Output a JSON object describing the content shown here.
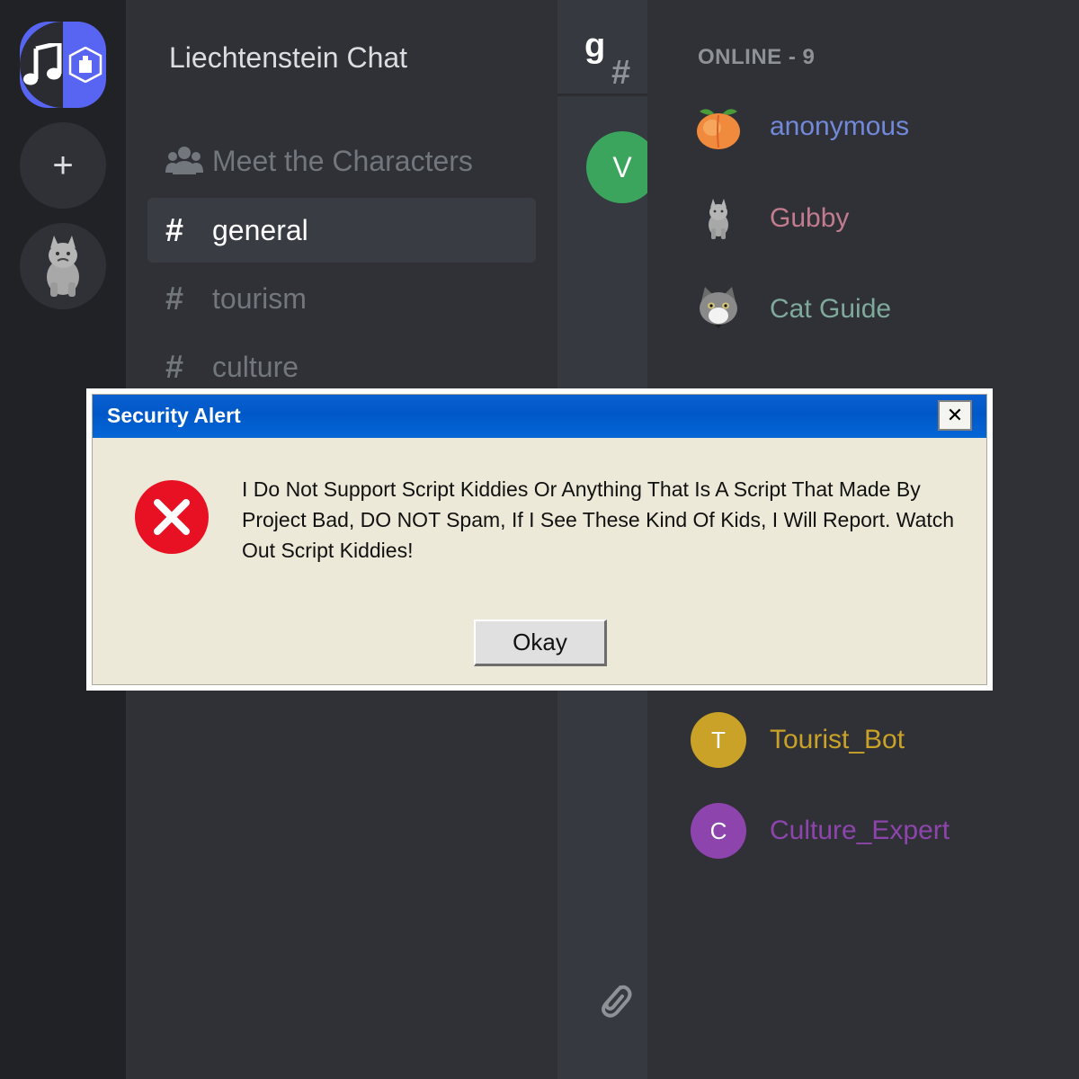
{
  "server_rail": {
    "add_label": "+"
  },
  "sidebar": {
    "guild_name": "Liechtenstein Chat",
    "items": [
      {
        "label": "Meet the Characters",
        "icon": "members-icon",
        "active": false
      },
      {
        "label": "general",
        "icon": "hash-icon",
        "active": true
      },
      {
        "label": "tourism",
        "icon": "hash-icon",
        "active": false
      },
      {
        "label": "culture",
        "icon": "hash-icon",
        "active": false
      }
    ],
    "hash_glyph": "#"
  },
  "chat": {
    "header_hash": "#",
    "header_channel": "g",
    "message_avatar_letter": "V",
    "message_avatar_color": "#3ba55d"
  },
  "member_list": {
    "header": "ONLINE - 9",
    "members": [
      {
        "name": "anonymous",
        "color": "#7289da",
        "avatar": "peach-icon"
      },
      {
        "name": "Gubby",
        "color": "#c27c8e",
        "avatar": "gubby-avatar"
      },
      {
        "name": "Cat Guide",
        "color": "#7fa99b",
        "avatar": "cat-avatar"
      },
      {
        "name": "Tourist_Bot",
        "color": "#c9a227",
        "avatar_letter": "T",
        "avatar_color": "#c9a227"
      },
      {
        "name": "Culture_Expert",
        "color": "#8e44ad",
        "avatar_letter": "C",
        "avatar_color": "#8e44ad"
      }
    ]
  },
  "dialog": {
    "title": "Security Alert",
    "close_glyph": "✕",
    "message": "I Do Not Support Script Kiddies Or Anything That Is A Script That Made By Project Bad, DO NOT Spam, If I See These Kind Of Kids, I Will Report. Watch Out Script Kiddies!",
    "button_label": "Okay",
    "error_color": "#e81123"
  }
}
